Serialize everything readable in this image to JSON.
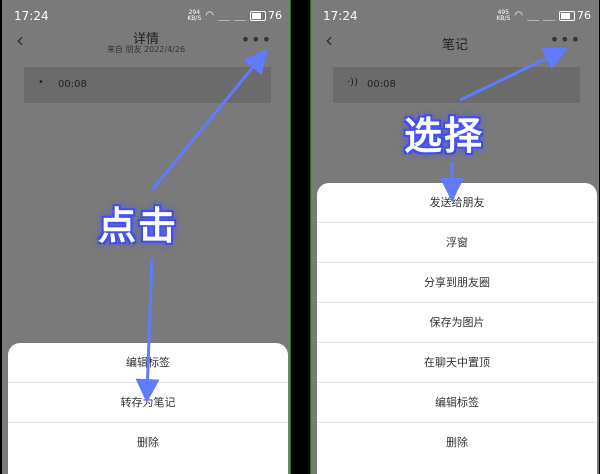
{
  "status": {
    "time": "17:24",
    "battery": "76",
    "speed_left_value": "294",
    "speed_right_value": "495",
    "speed_unit": "KB/S"
  },
  "left": {
    "title": "详情",
    "subtitle": "来自 朋友 2022/4/26",
    "voice_duration": "00:08",
    "menu_items": [
      "编辑标签",
      "转存为笔记",
      "删除"
    ],
    "overlay": "点击"
  },
  "right": {
    "title": "笔记",
    "voice_duration": "00:08",
    "menu_items": [
      "发送给朋友",
      "浮窗",
      "分享到朋友圈",
      "保存为图片",
      "在聊天中置顶",
      "编辑标签",
      "删除"
    ],
    "overlay": "选择"
  },
  "icons": {
    "back": "back-chevron-icon",
    "more": "more-dots-icon",
    "voice": "voice-wave-icon"
  },
  "colors": {
    "arrow": "#5f7bff",
    "overlay_glow": "#4b59ff"
  }
}
